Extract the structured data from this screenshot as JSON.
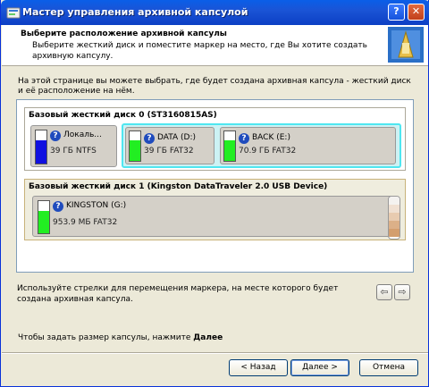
{
  "window": {
    "title": "Мастер управления архивной капсулой",
    "help_label": "?",
    "close_label": "✕"
  },
  "header": {
    "title": "Выберите расположение архивной капсулы",
    "subtitle": "Выберите жесткий диск и поместите маркер на место, где Вы хотите создать архивную капсулу."
  },
  "intro": "На этой странице вы можете выбрать, где будет создана архивная капсула - жесткий диск и её расположение на нём.",
  "disks": [
    {
      "title": "Базовый жесткий диск 0 (ST3160815AS)",
      "partitions": [
        {
          "name": "Локаль...",
          "size": "39 ГБ NTFS",
          "bar_color": "#1010e0"
        },
        {
          "name": "DATA (D:)",
          "size": "39 ГБ FAT32",
          "bar_color": "#22ee22"
        },
        {
          "name": "BACK (E:)",
          "size": "70.9 ГБ FAT32",
          "bar_color": "#22ee22"
        }
      ]
    },
    {
      "title": "Базовый жесткий диск 1 (Kingston DataTraveler 2.0 USB Device)",
      "partitions": [
        {
          "name": "KINGSTON (G:)",
          "size": "953.9 МБ FAT32",
          "bar_color": "#22ee22"
        }
      ]
    }
  ],
  "hint": "Используйте стрелки для перемещения маркера, на месте которого будет создана архивная капсула.",
  "arrows": {
    "left": "⇦",
    "right": "⇨"
  },
  "footer": {
    "prefix": "Чтобы задать размер капсулы, нажмите ",
    "bold": "Далее"
  },
  "buttons": {
    "back": "< Назад",
    "next": "Далее >",
    "cancel": "Отмена"
  },
  "colors": {
    "titlebar": "#0a5fe8",
    "selected_border": "#4fe6f0",
    "partition_bg": "#d4d0c8"
  }
}
